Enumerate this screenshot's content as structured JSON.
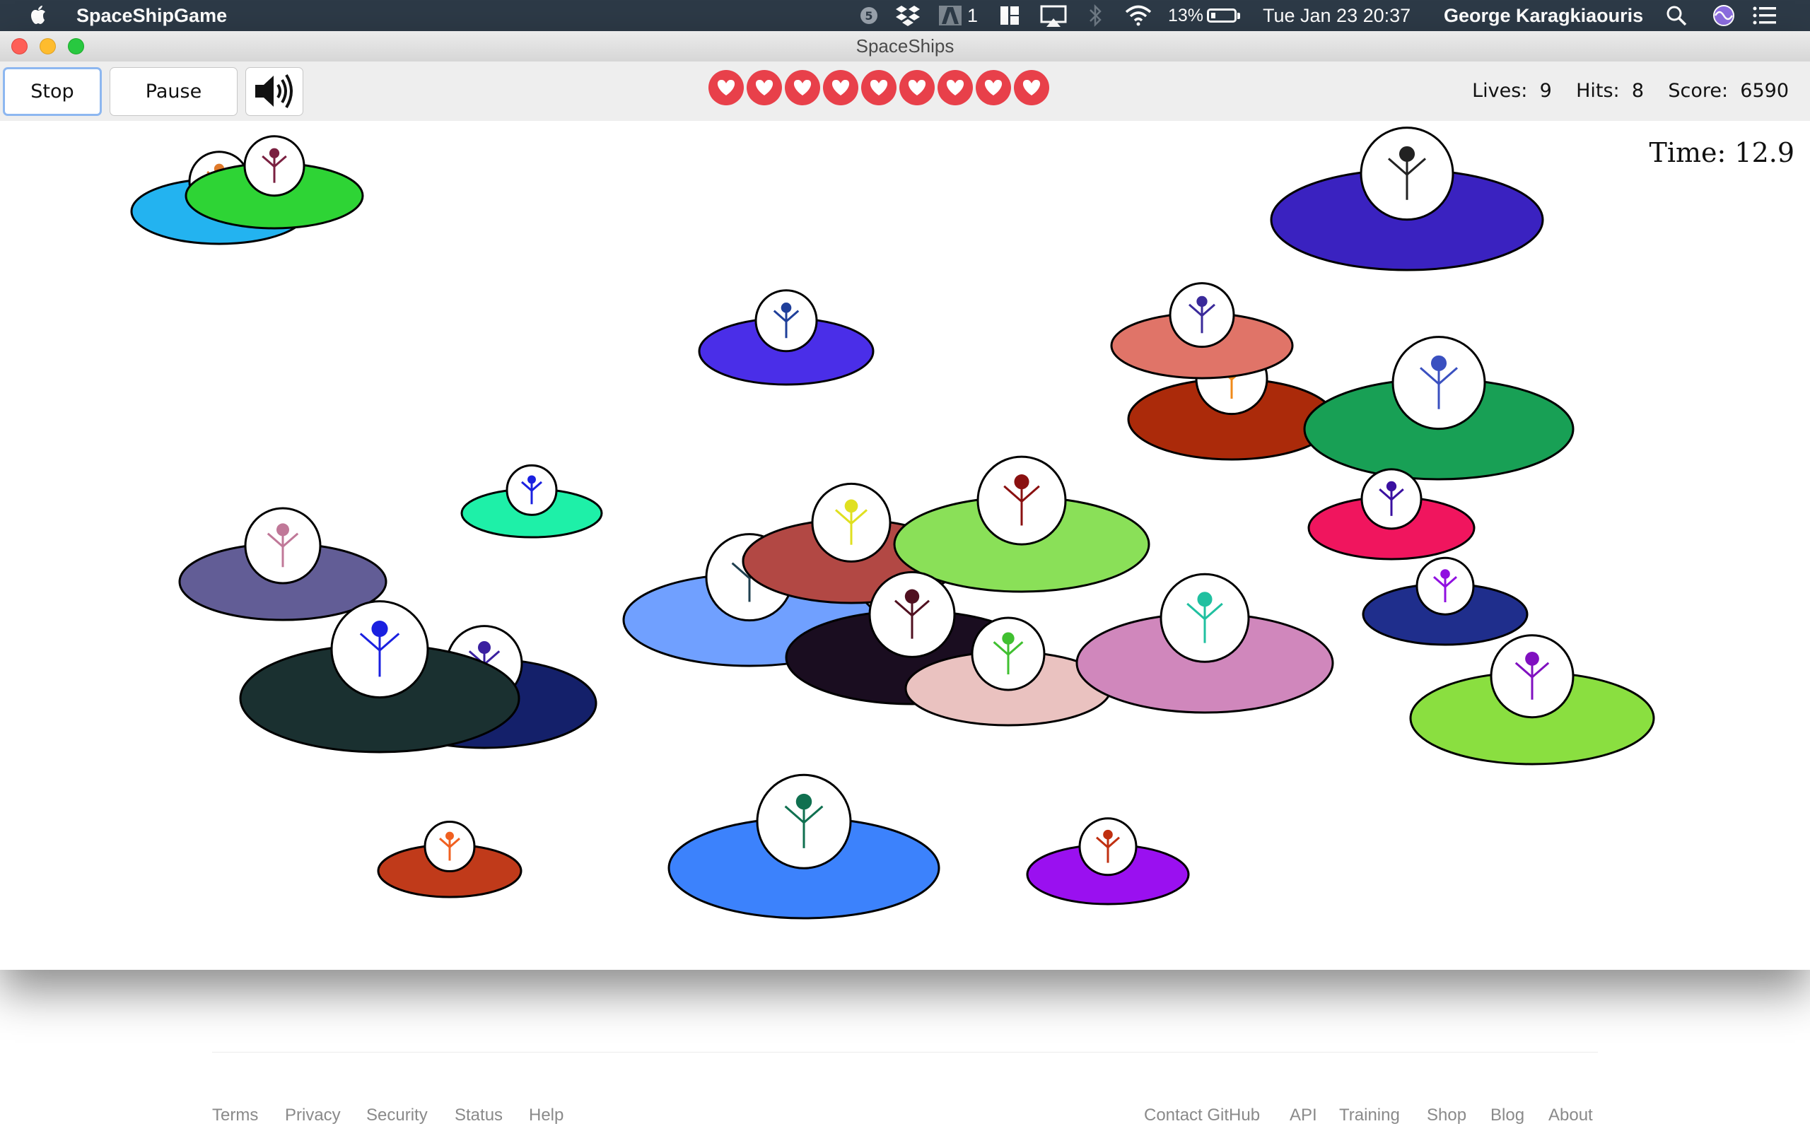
{
  "menubar": {
    "app_name": "SpaceShipGame",
    "status_badge": "5",
    "adobe_count": "1",
    "battery_percent": "13%",
    "datetime": "Tue Jan 23  20:37",
    "user": "George Karagkiaouris",
    "icons": [
      "apple-icon",
      "badge-5-icon",
      "dropbox-icon",
      "adobe-icon",
      "layout-icon",
      "airplay-icon",
      "bluetooth-icon",
      "wifi-icon",
      "battery-icon",
      "search-icon",
      "siri-icon",
      "list-icon"
    ]
  },
  "window": {
    "title": "SpaceShips"
  },
  "toolbar": {
    "stop_label": "Stop",
    "pause_label": "Pause",
    "sound_icon": "speaker-icon",
    "heart_icon": "heart-icon",
    "heart_color": "#e8404a",
    "lives_label": "Lives:",
    "lives_value": "9",
    "hits_label": "Hits:",
    "hits_value": "8",
    "score_label": "Score:",
    "score_value": "6590"
  },
  "game": {
    "time_text": "Time: 12.9"
  },
  "footer": {
    "left_links": [
      "Terms",
      "Privacy",
      "Security",
      "Status",
      "Help"
    ],
    "right_links": [
      "Contact GitHub",
      "API",
      "Training",
      "Shop",
      "Blog",
      "About"
    ]
  },
  "colors": {
    "menubar_bg": "#2d3a47",
    "canvas_bg": "#ffffff",
    "ships": [
      "#23b3f0",
      "#2ed435",
      "#3a22c0",
      "#4a2ee8",
      "#ab2a0a",
      "#e07468",
      "#18a055",
      "#1ef0a8",
      "#f0155e",
      "#625d96",
      "#1a3030",
      "#14206a",
      "#70a0ff",
      "#b24844",
      "#8ae058",
      "#1f2e8c",
      "#1a0d20",
      "#eac2c0",
      "#d087bc",
      "#8adf40",
      "#c03a1a",
      "#3c82fc",
      "#9a10f0"
    ]
  }
}
